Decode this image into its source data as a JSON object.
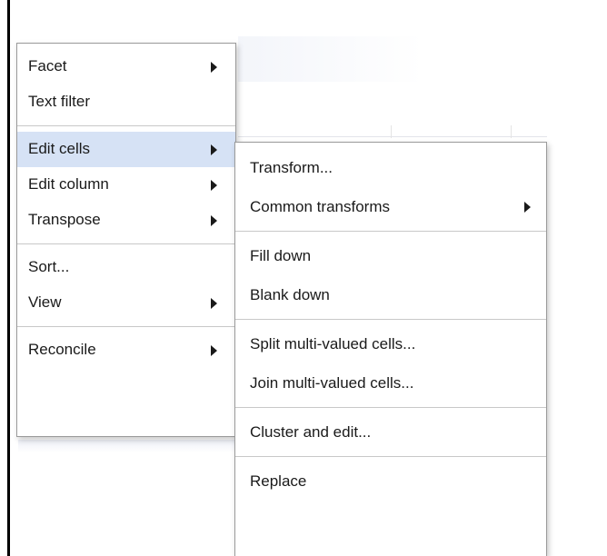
{
  "main_menu": {
    "items": [
      {
        "label": "Facet",
        "submenu": true
      },
      {
        "label": "Text filter",
        "submenu": false
      },
      {
        "separator": true
      },
      {
        "label": "Edit cells",
        "submenu": true,
        "active": true
      },
      {
        "label": "Edit column",
        "submenu": true
      },
      {
        "label": "Transpose",
        "submenu": true
      },
      {
        "separator": true
      },
      {
        "label": "Sort...",
        "submenu": false
      },
      {
        "label": "View",
        "submenu": true
      },
      {
        "separator": true
      },
      {
        "label": "Reconcile",
        "submenu": true
      }
    ]
  },
  "edit_cells_submenu": {
    "items": [
      {
        "label": "Transform...",
        "submenu": false
      },
      {
        "label": "Common transforms",
        "submenu": true
      },
      {
        "separator": true
      },
      {
        "label": "Fill down",
        "submenu": false
      },
      {
        "label": "Blank down",
        "submenu": false
      },
      {
        "separator": true
      },
      {
        "label": "Split multi-valued cells...",
        "submenu": false
      },
      {
        "label": "Join multi-valued cells...",
        "submenu": false
      },
      {
        "separator": true
      },
      {
        "label": "Cluster and edit...",
        "submenu": false
      },
      {
        "separator": true
      },
      {
        "label": "Replace",
        "submenu": false,
        "highlighted": true
      }
    ]
  },
  "colors": {
    "active_item_bg": "#d6e2f5",
    "highlight_marker": "#fff35c",
    "menu_border": "#9a9a9a"
  },
  "icons": {
    "submenu_indicator": "triangle-right-icon"
  }
}
